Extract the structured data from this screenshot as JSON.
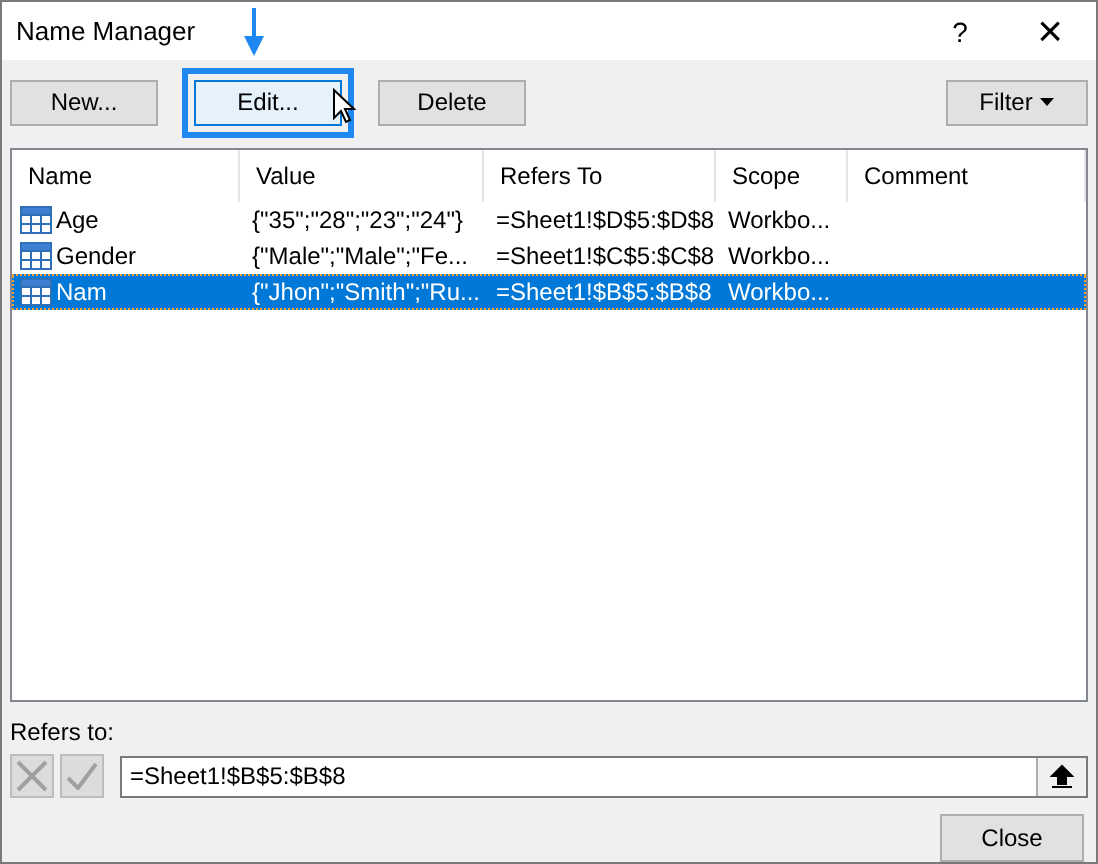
{
  "window": {
    "title": "Name Manager",
    "help": "?",
    "close": "×"
  },
  "toolbar": [
    {
      "label": "New...",
      "selected": false
    },
    {
      "label": "Edit...",
      "selected": true
    },
    {
      "label": "Delete",
      "selected": false
    }
  ],
  "filter": {
    "label": "Filter"
  },
  "table": {
    "columns": [
      "Name",
      "Value",
      "Refers To",
      "Scope",
      "Comment"
    ],
    "rows": [
      {
        "cells": [
          "Age",
          "{\"35\";\"28\";\"23\";\"24\"}",
          "=Sheet1!$D$5:$D$8",
          "Workbo..."
        ],
        "selected": false
      },
      {
        "cells": [
          "Gender",
          "{\"Male\";\"Male\";\"Fe...",
          "=Sheet1!$C$5:$C$8",
          "Workbo..."
        ],
        "selected": false
      },
      {
        "cells": [
          "Nam",
          "{\"Jhon\";\"Smith\";\"Ru...",
          "=Sheet1!$B$5:$B$8",
          "Workbo..."
        ],
        "selected": true
      }
    ]
  },
  "refers_to": {
    "label": "Refers to:",
    "value": "=Sheet1!$B$5:$B$8"
  },
  "close_button": {
    "label": "Close"
  }
}
